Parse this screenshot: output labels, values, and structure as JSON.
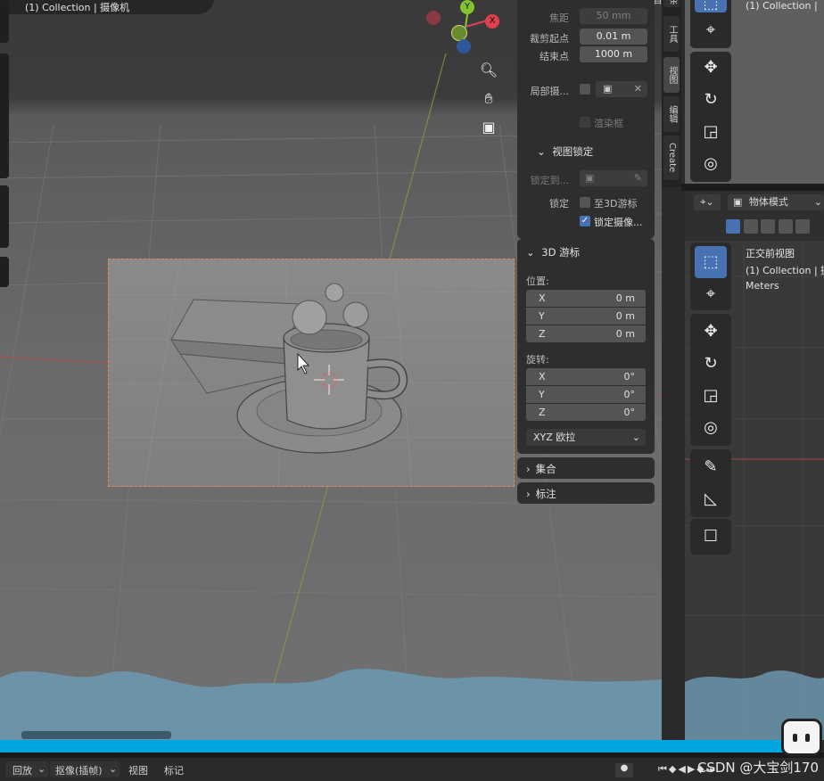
{
  "viewport": {
    "overlay_title": "(1) Collection | 摄像机"
  },
  "gizmo": {
    "y_label": "Y",
    "x_label": "X",
    "colors": {
      "x": "#e0404d",
      "y": "#85c430",
      "z": "#3b7fd6"
    }
  },
  "nav_icons": [
    "zoom-icon",
    "hand-pan-icon",
    "camera-view-icon"
  ],
  "npanel": {
    "focal_label": "焦距",
    "focal_value": "50 mm",
    "clip_start_label": "裁剪起点",
    "clip_start_value": "0.01 m",
    "clip_end_label": "结束点",
    "clip_end_value": "1000 m",
    "local_camera_label": "局部摄...",
    "render_region_label": "渲染框",
    "view_lock_title": "视图锁定",
    "lock_to_label": "锁定到...",
    "lock_label": "锁定",
    "lock_3d_cursor_label": "至3D游标",
    "lock_camera_label": "锁定摄像...",
    "cursor_title": "3D 游标",
    "location_label": "位置:",
    "location": [
      {
        "axis": "X",
        "value": "0 m"
      },
      {
        "axis": "Y",
        "value": "0 m"
      },
      {
        "axis": "Z",
        "value": "0 m"
      }
    ],
    "rotation_label": "旋转:",
    "rotation": [
      {
        "axis": "X",
        "value": "0°"
      },
      {
        "axis": "Y",
        "value": "0°"
      },
      {
        "axis": "Z",
        "value": "0°"
      }
    ],
    "rotation_mode": "XYZ 欧拉",
    "collection_title": "集合",
    "annotation_title": "标注"
  },
  "side_tabs": [
    "条目",
    "工具",
    "视图",
    "编辑",
    "Create"
  ],
  "right": {
    "top_title": "(1) Collection |",
    "mode_label": "物体模式",
    "view_title": "正交前视图",
    "collection_line": "(1) Collection | 摄",
    "units": "Meters"
  },
  "timeline": {
    "playback": "回放",
    "keying": "抠像(插帧)",
    "view": "视图",
    "marker": "标记"
  },
  "progress": 0.95,
  "watermark": "CSDN @大宝剑170"
}
